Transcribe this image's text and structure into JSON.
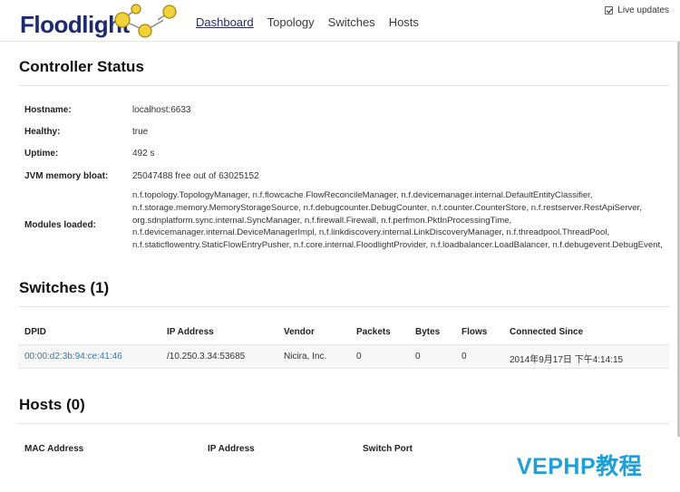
{
  "brand": {
    "name": "Floodlight"
  },
  "nav": {
    "dashboard": "Dashboard",
    "topology": "Topology",
    "switches": "Switches",
    "hosts": "Hosts"
  },
  "live_updates": {
    "label": "Live updates",
    "checked": true
  },
  "controller": {
    "title": "Controller Status",
    "hostname_label": "Hostname:",
    "hostname": "localhost:6633",
    "healthy_label": "Healthy:",
    "healthy": "true",
    "uptime_label": "Uptime:",
    "uptime": "492 s",
    "jvm_label": "JVM memory bloat:",
    "jvm": "25047488 free out of 63025152",
    "modules_label": "Modules loaded:",
    "modules": "n.f.topology.TopologyManager, n.f.flowcache.FlowReconcileManager, n.f.devicemanager.internal.DefaultEntityClassifier, n.f.storage.memory.MemoryStorageSource, n.f.debugcounter.DebugCounter, n.f.counter.CounterStore, n.f.restserver.RestApiServer, org.sdnplatform.sync.internal.SyncManager, n.f.firewall.Firewall, n.f.perfmon.PktInProcessingTime, n.f.devicemanager.internal.DeviceManagerImpl, n.f.linkdiscovery.internal.LinkDiscoveryManager, n.f.threadpool.ThreadPool, n.f.staticflowentry.StaticFlowEntryPusher, n.f.core.internal.FloodlightProvider, n.f.loadbalancer.LoadBalancer, n.f.debugevent.DebugEvent,"
  },
  "switches": {
    "title": "Switches (1)",
    "headers": {
      "dpid": "DPID",
      "ip": "IP Address",
      "vendor": "Vendor",
      "packets": "Packets",
      "bytes": "Bytes",
      "flows": "Flows",
      "since": "Connected Since"
    },
    "rows": [
      {
        "dpid": "00:00:d2:3b:94:ce:41:46",
        "ip": "/10.250.3.34:53685",
        "vendor": "Nicira, Inc.",
        "packets": "0",
        "bytes": "0",
        "flows": "0",
        "since": "2014年9月17日 下午4:14:15"
      }
    ]
  },
  "hosts": {
    "title": "Hosts (0)",
    "headers": {
      "mac": "MAC Address",
      "ip": "IP Address",
      "port": "Switch Port"
    }
  },
  "watermark": "VEPHP教程",
  "colors": {
    "brand": "#1c2a72",
    "link": "#2a7db0",
    "node": "#f2d23a",
    "watermark": "#1ea0d6"
  }
}
